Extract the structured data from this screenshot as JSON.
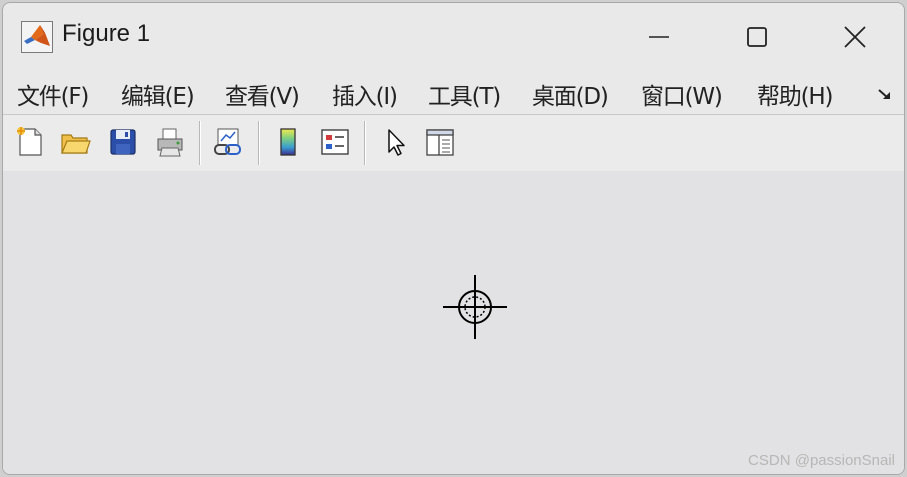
{
  "window": {
    "title": "Figure 1",
    "controls": {
      "minimize_icon": "minimize-icon",
      "maximize_icon": "maximize-icon",
      "close_icon": "close-icon"
    }
  },
  "menubar": {
    "items": [
      {
        "label": "文件(F)"
      },
      {
        "label": "编辑(E)"
      },
      {
        "label": "查看(V)"
      },
      {
        "label": "插入(I)"
      },
      {
        "label": "工具(T)"
      },
      {
        "label": "桌面(D)"
      },
      {
        "label": "窗口(W)"
      },
      {
        "label": "帮助(H)"
      }
    ],
    "overflow_icon": "dock-arrow-icon"
  },
  "toolbar": {
    "buttons": [
      {
        "icon": "new-figure-icon"
      },
      {
        "icon": "open-file-icon"
      },
      {
        "icon": "save-icon"
      },
      {
        "icon": "print-icon"
      },
      {
        "icon": "link-plot-icon"
      },
      {
        "icon": "colorbar-icon"
      },
      {
        "icon": "legend-icon"
      },
      {
        "icon": "edit-plot-pointer-icon"
      },
      {
        "icon": "property-editor-icon"
      }
    ]
  },
  "canvas": {
    "cursor": "crosshair-cursor-icon",
    "background": "#e2e1e3"
  },
  "watermark": "CSDN @passionSnail",
  "colors": {
    "window_bg": "#e9e9e9",
    "toolbar_bg": "#ebebeb",
    "text": "#222222"
  }
}
